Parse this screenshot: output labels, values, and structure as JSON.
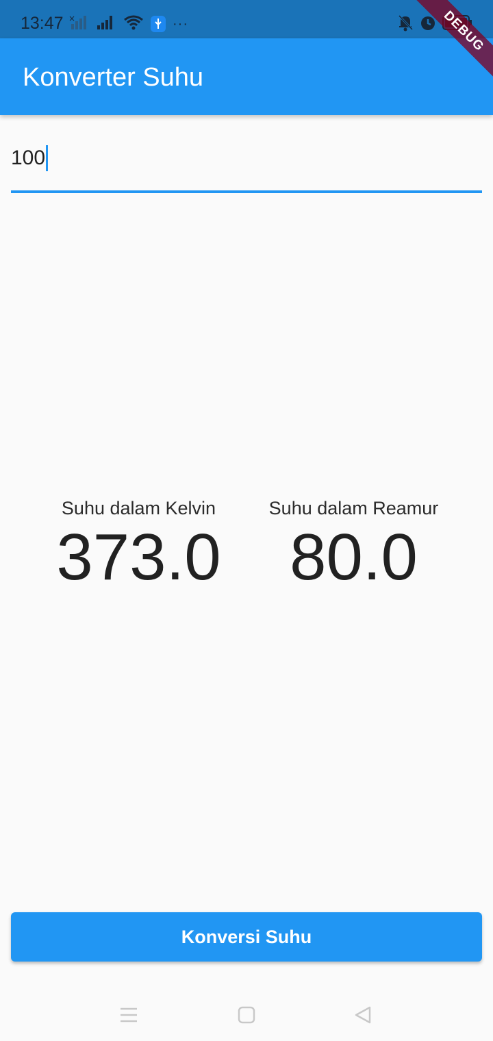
{
  "status_bar": {
    "time": "13:47",
    "icons": [
      "signal-no-data-icon",
      "signal-icon",
      "wifi-icon",
      "usb-icon",
      "more-icon",
      "mute-icon",
      "alarm-icon",
      "battery-icon"
    ],
    "more": "···"
  },
  "debug_banner": "DEBUG",
  "app_bar": {
    "title": "Konverter Suhu"
  },
  "input": {
    "value": "100",
    "placeholder": ""
  },
  "results": {
    "kelvin": {
      "label": "Suhu dalam Kelvin",
      "value": "373.0"
    },
    "reamur": {
      "label": "Suhu dalam Reamur",
      "value": "80.0"
    }
  },
  "button": {
    "label": "Konversi Suhu"
  },
  "nav_bar": {
    "icons": [
      "menu-icon",
      "home-icon",
      "back-icon"
    ]
  },
  "colors": {
    "primary": "#2196f3",
    "status_bar": "#1a73b8",
    "background": "#fafafa",
    "debug": "#800020"
  }
}
